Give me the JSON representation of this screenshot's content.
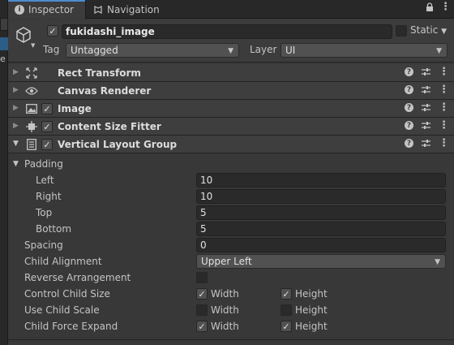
{
  "tabs": [
    {
      "label": "Inspector",
      "icon": "info-icon",
      "active": true
    },
    {
      "label": "Navigation",
      "icon": "navigation-icon",
      "active": false
    }
  ],
  "gameobject": {
    "name": "fukidashi_image",
    "active": true,
    "static_label": "Static",
    "static": false,
    "tag_label": "Tag",
    "tag_value": "Untagged",
    "layer_label": "Layer",
    "layer_value": "UI"
  },
  "components": [
    {
      "name": "Rect Transform",
      "icon": "rect-transform-icon",
      "has_checkbox": false,
      "expanded": false
    },
    {
      "name": "Canvas Renderer",
      "icon": "eye-icon",
      "has_checkbox": false,
      "expanded": false
    },
    {
      "name": "Image",
      "icon": "image-icon",
      "has_checkbox": true,
      "enabled": true,
      "expanded": false
    },
    {
      "name": "Content Size Fitter",
      "icon": "content-size-fitter-icon",
      "has_checkbox": true,
      "enabled": true,
      "expanded": false
    },
    {
      "name": "Vertical Layout Group",
      "icon": "vertical-layout-icon",
      "has_checkbox": true,
      "enabled": true,
      "expanded": true
    }
  ],
  "layout_group": {
    "padding_label": "Padding",
    "left_label": "Left",
    "left": "10",
    "right_label": "Right",
    "right": "10",
    "top_label": "Top",
    "top": "5",
    "bottom_label": "Bottom",
    "bottom": "5",
    "spacing_label": "Spacing",
    "spacing": "0",
    "child_alignment_label": "Child Alignment",
    "child_alignment": "Upper Left",
    "reverse_label": "Reverse Arrangement",
    "reverse": false,
    "control_size_label": "Control Child Size",
    "control_size_width": true,
    "control_size_height": true,
    "use_scale_label": "Use Child Scale",
    "use_scale_width": false,
    "use_scale_height": false,
    "force_expand_label": "Child Force Expand",
    "force_expand_width": true,
    "force_expand_height": true,
    "width_label": "Width",
    "height_label": "Height"
  },
  "colors": {
    "panel_bg": "#383838",
    "header_bg": "#3e3e3e",
    "field_bg": "#2a2a2a",
    "accent": "#4d8ccc"
  }
}
